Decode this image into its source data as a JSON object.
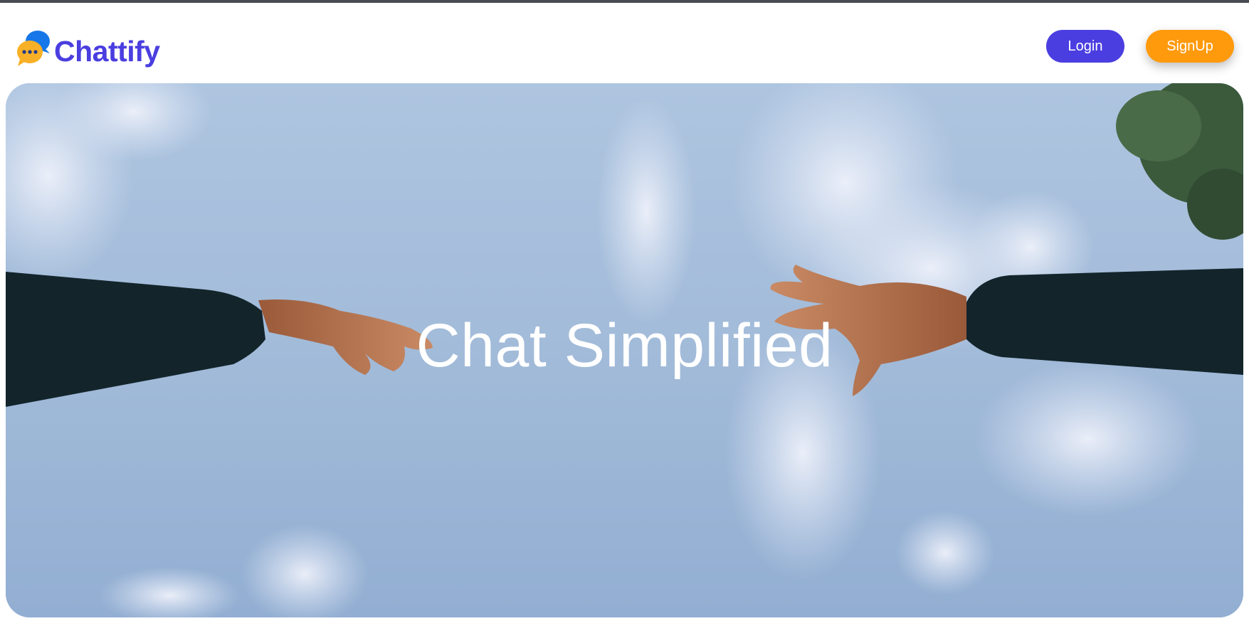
{
  "brand": {
    "name": "Chattify",
    "logo_icon": "chat-bubbles-icon",
    "color": "#4a3ee0"
  },
  "nav": {
    "login_label": "Login",
    "signup_label": "SignUp",
    "login_color": "#4a3ee0",
    "signup_color": "#ff9a0d"
  },
  "hero": {
    "title": "Chat Simplified",
    "image": "two hands reaching toward each other against a cloudy blue sky"
  }
}
